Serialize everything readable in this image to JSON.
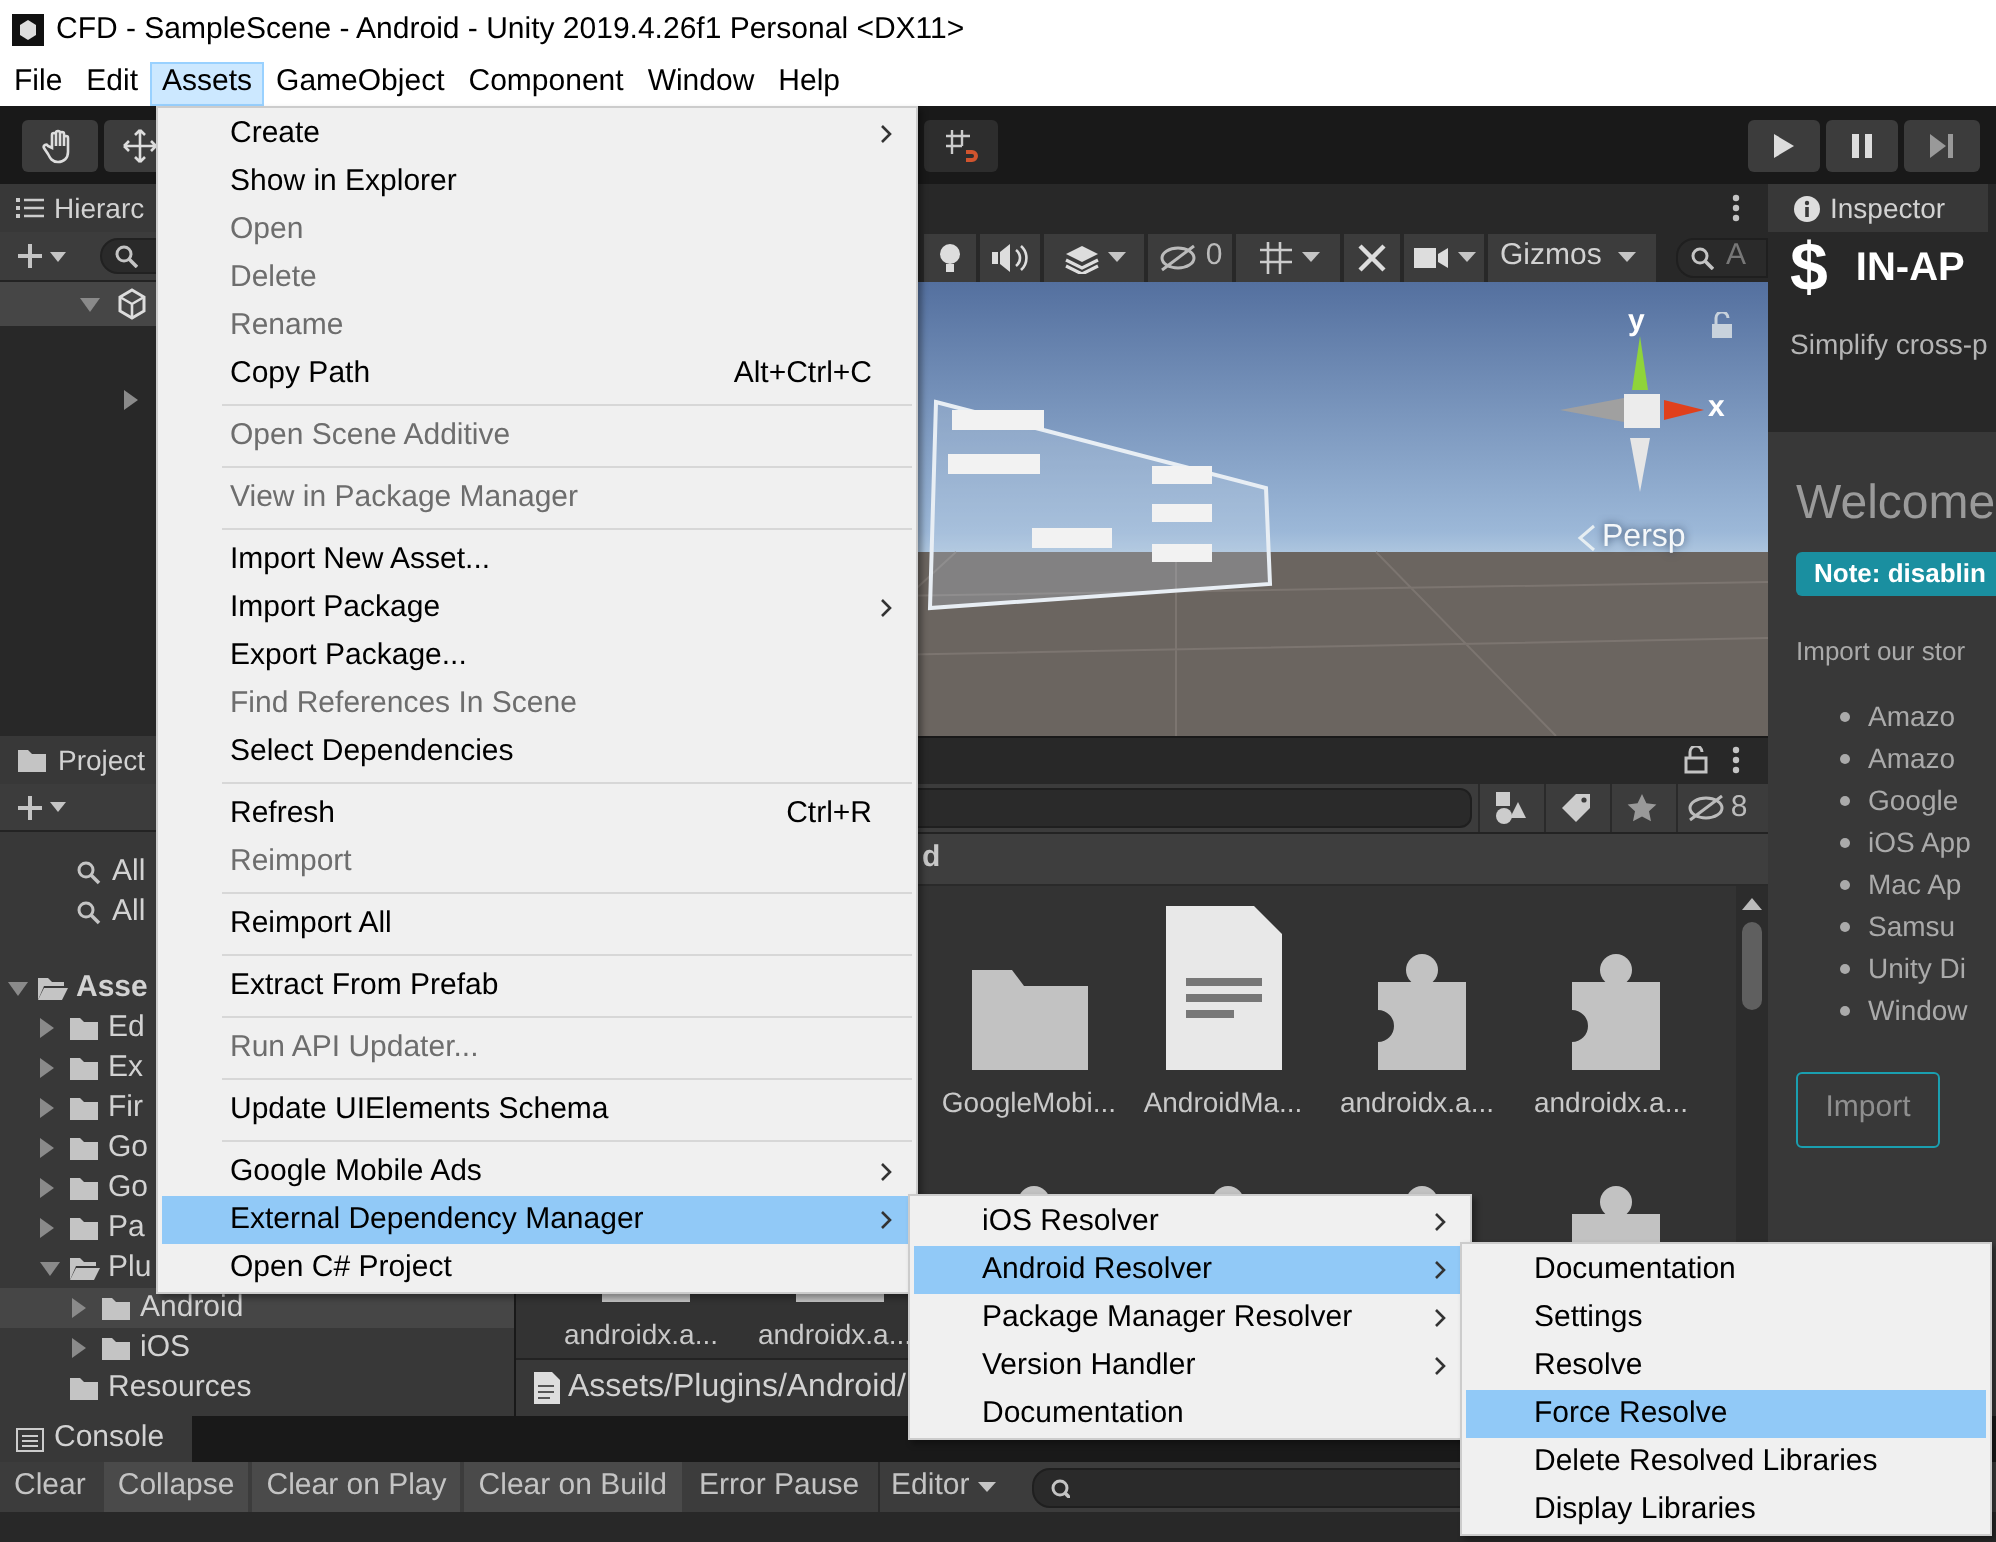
{
  "window": {
    "title": "CFD - SampleScene - Android - Unity 2019.4.26f1 Personal <DX11>"
  },
  "menu_bar": [
    {
      "label": "File",
      "selected": false
    },
    {
      "label": "Edit",
      "selected": false
    },
    {
      "label": "Assets",
      "selected": true
    },
    {
      "label": "GameObject",
      "selected": false
    },
    {
      "label": "Component",
      "selected": false
    },
    {
      "label": "Window",
      "selected": false
    },
    {
      "label": "Help",
      "selected": false
    }
  ],
  "hierarchy": {
    "title": "Hierarc",
    "tree": [
      {
        "expanded": true,
        "children": [
          {
            "expanded": false
          }
        ]
      }
    ]
  },
  "scene": {
    "hidden_count": "0",
    "gizmos": "Gizmos",
    "search_placeholder": "A",
    "y_label": "y",
    "x_label": "x",
    "projection": "Persp"
  },
  "inspector": {
    "title": "Inspector",
    "logo": "$",
    "heading": "IN-AP",
    "tagline": "Simplify cross-p",
    "welcome": "Welcome",
    "note": "Note: disablin",
    "intro": "Import our stor",
    "stores": [
      "Amazo",
      "Amazo",
      "Google",
      "iOS App",
      "Mac Ap",
      "Samsu",
      "Unity Di",
      "Window"
    ],
    "button": "Import"
  },
  "project": {
    "title": "Project",
    "searches": [
      "All",
      "All"
    ],
    "tree": [
      {
        "label": "Asse",
        "expanded": true,
        "selected": false,
        "children": [
          {
            "label": "Ed",
            "expanded": false,
            "selected": false
          },
          {
            "label": "Ex",
            "expanded": false,
            "selected": false
          },
          {
            "label": "Fir",
            "expanded": false,
            "selected": false
          },
          {
            "label": "Go",
            "expanded": false,
            "selected": false
          },
          {
            "label": "Go",
            "expanded": false,
            "selected": false
          },
          {
            "label": "Pa",
            "expanded": false,
            "selected": false
          },
          {
            "label": "Plu",
            "expanded": true,
            "selected": false,
            "children": [
              {
                "label": "Android",
                "expanded": false,
                "selected": true
              },
              {
                "label": "iOS",
                "expanded": false,
                "selected": false
              }
            ]
          },
          {
            "label": "Resources",
            "selected": false
          }
        ]
      }
    ],
    "breadcrumb": "d",
    "hidden_count": "8",
    "assets_row_1": [
      {
        "kind": "folder",
        "label": "GoogleMobi..."
      },
      {
        "kind": "document",
        "label": "AndroidMa..."
      },
      {
        "kind": "plugin",
        "label": "androidx.a..."
      },
      {
        "kind": "plugin",
        "label": "androidx.a..."
      }
    ],
    "assets_row_2": [
      {
        "kind": "plugin",
        "label": "androidx.a..."
      },
      {
        "kind": "plugin",
        "label": "androidx.a..."
      },
      {
        "kind": "plugin"
      },
      {
        "kind": "plugin"
      },
      {
        "kind": "plugin"
      },
      {
        "kind": "plugin"
      }
    ],
    "path": "Assets/Plugins/Android/"
  },
  "console": {
    "title": "Console",
    "buttons": [
      {
        "label": "Clear",
        "on": false
      },
      {
        "label": "Collapse",
        "on": true
      },
      {
        "label": "Clear on Play",
        "on": true
      },
      {
        "label": "Clear on Build",
        "on": true
      },
      {
        "label": "Error Pause",
        "on": false
      }
    ],
    "dropdown": "Editor"
  },
  "assets_menu": [
    {
      "kind": "item",
      "label": "Create",
      "submenu": true,
      "disabled": false,
      "selected": false
    },
    {
      "kind": "item",
      "label": "Show in Explorer",
      "disabled": false,
      "selected": false
    },
    {
      "kind": "item",
      "label": "Open",
      "disabled": true,
      "selected": false
    },
    {
      "kind": "item",
      "label": "Delete",
      "disabled": true,
      "selected": false
    },
    {
      "kind": "item",
      "label": "Rename",
      "disabled": true,
      "selected": false
    },
    {
      "kind": "item",
      "label": "Copy Path",
      "shortcut": "Alt+Ctrl+C",
      "disabled": false,
      "selected": false
    },
    {
      "kind": "separator"
    },
    {
      "kind": "item",
      "label": "Open Scene Additive",
      "disabled": true,
      "selected": false
    },
    {
      "kind": "separator"
    },
    {
      "kind": "item",
      "label": "View in Package Manager",
      "disabled": true,
      "selected": false
    },
    {
      "kind": "separator"
    },
    {
      "kind": "item",
      "label": "Import New Asset...",
      "disabled": false,
      "selected": false
    },
    {
      "kind": "item",
      "label": "Import Package",
      "submenu": true,
      "disabled": false,
      "selected": false
    },
    {
      "kind": "item",
      "label": "Export Package...",
      "disabled": false,
      "selected": false
    },
    {
      "kind": "item",
      "label": "Find References In Scene",
      "disabled": true,
      "selected": false
    },
    {
      "kind": "item",
      "label": "Select Dependencies",
      "disabled": false,
      "selected": false
    },
    {
      "kind": "separator"
    },
    {
      "kind": "item",
      "label": "Refresh",
      "shortcut": "Ctrl+R",
      "disabled": false,
      "selected": false
    },
    {
      "kind": "item",
      "label": "Reimport",
      "disabled": true,
      "selected": false
    },
    {
      "kind": "separator"
    },
    {
      "kind": "item",
      "label": "Reimport All",
      "disabled": false,
      "selected": false
    },
    {
      "kind": "separator"
    },
    {
      "kind": "item",
      "label": "Extract From Prefab",
      "disabled": false,
      "selected": false
    },
    {
      "kind": "separator"
    },
    {
      "kind": "item",
      "label": "Run API Updater...",
      "disabled": true,
      "selected": false
    },
    {
      "kind": "separator"
    },
    {
      "kind": "item",
      "label": "Update UIElements Schema",
      "disabled": false,
      "selected": false
    },
    {
      "kind": "separator"
    },
    {
      "kind": "item",
      "label": "Google Mobile Ads",
      "submenu": true,
      "disabled": false,
      "selected": false
    },
    {
      "kind": "item",
      "label": "External Dependency Manager",
      "submenu": true,
      "disabled": false,
      "selected": true
    },
    {
      "kind": "item",
      "label": "Open C# Project",
      "disabled": false,
      "selected": false
    }
  ],
  "dependency_submenu": [
    {
      "kind": "item",
      "label": "iOS Resolver",
      "submenu": true,
      "disabled": false,
      "selected": false
    },
    {
      "kind": "item",
      "label": "Android Resolver",
      "submenu": true,
      "disabled": false,
      "selected": true
    },
    {
      "kind": "item",
      "label": "Package Manager Resolver",
      "submenu": true,
      "disabled": false,
      "selected": false
    },
    {
      "kind": "item",
      "label": "Version Handler",
      "submenu": true,
      "disabled": false,
      "selected": false
    },
    {
      "kind": "item",
      "label": "Documentation",
      "disabled": false,
      "selected": false
    }
  ],
  "android_submenu": [
    {
      "kind": "item",
      "label": "Documentation",
      "disabled": false,
      "selected": false
    },
    {
      "kind": "item",
      "label": "Settings",
      "disabled": false,
      "selected": false
    },
    {
      "kind": "item",
      "label": "Resolve",
      "disabled": false,
      "selected": false
    },
    {
      "kind": "item",
      "label": "Force Resolve",
      "disabled": false,
      "selected": true
    },
    {
      "kind": "item",
      "label": "Delete Resolved Libraries",
      "disabled": false,
      "selected": false
    },
    {
      "kind": "item",
      "label": "Display Libraries",
      "disabled": false,
      "selected": false
    }
  ]
}
